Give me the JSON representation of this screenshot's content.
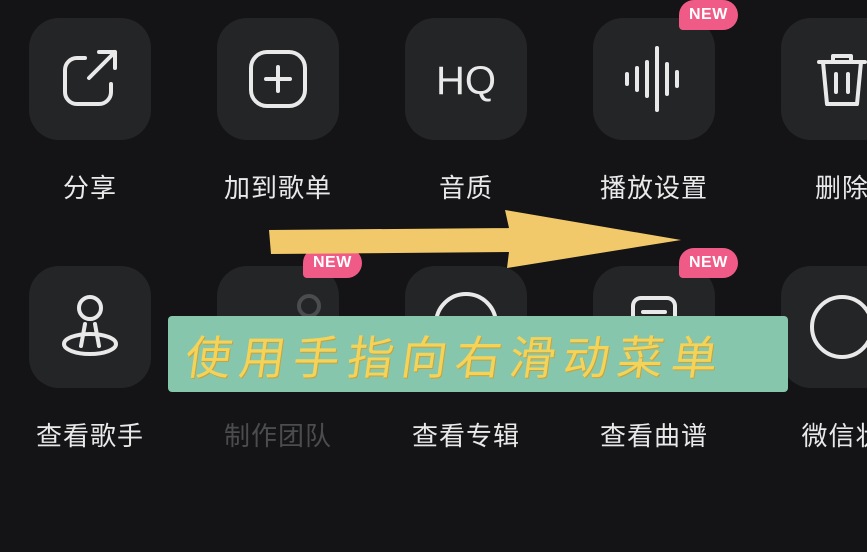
{
  "menu_rows": [
    [
      {
        "label": "分享",
        "icon": "share-icon",
        "badge": ""
      },
      {
        "label": "加到歌单",
        "icon": "add-to-playlist-icon",
        "badge": ""
      },
      {
        "label": "音质",
        "icon": "hq-icon",
        "icon_text": "HQ",
        "badge": ""
      },
      {
        "label": "播放设置",
        "icon": "waveform-icon",
        "badge": "NEW"
      },
      {
        "label": "删除",
        "icon": "trash-icon",
        "badge": ""
      }
    ],
    [
      {
        "label": "查看歌手",
        "icon": "singer-icon",
        "badge": ""
      },
      {
        "label": "制作团队",
        "icon": "team-icon",
        "badge": "NEW",
        "disabled": true
      },
      {
        "label": "查看专辑",
        "icon": "album-icon",
        "badge": ""
      },
      {
        "label": "查看曲谱",
        "icon": "score-icon",
        "badge": "NEW"
      },
      {
        "label": "微信状",
        "icon": "wechat-status-icon",
        "badge": ""
      }
    ]
  ],
  "overlay": {
    "instruction": "使用手指向右滑动菜单",
    "arrow_color": "#f2c96a",
    "banner_color": "#86c6ad",
    "text_color": "#f3d35a"
  },
  "colors": {
    "background": "#141416",
    "tile": "#242527",
    "icon": "#e9e9ea",
    "badge": "#ef5b86"
  }
}
